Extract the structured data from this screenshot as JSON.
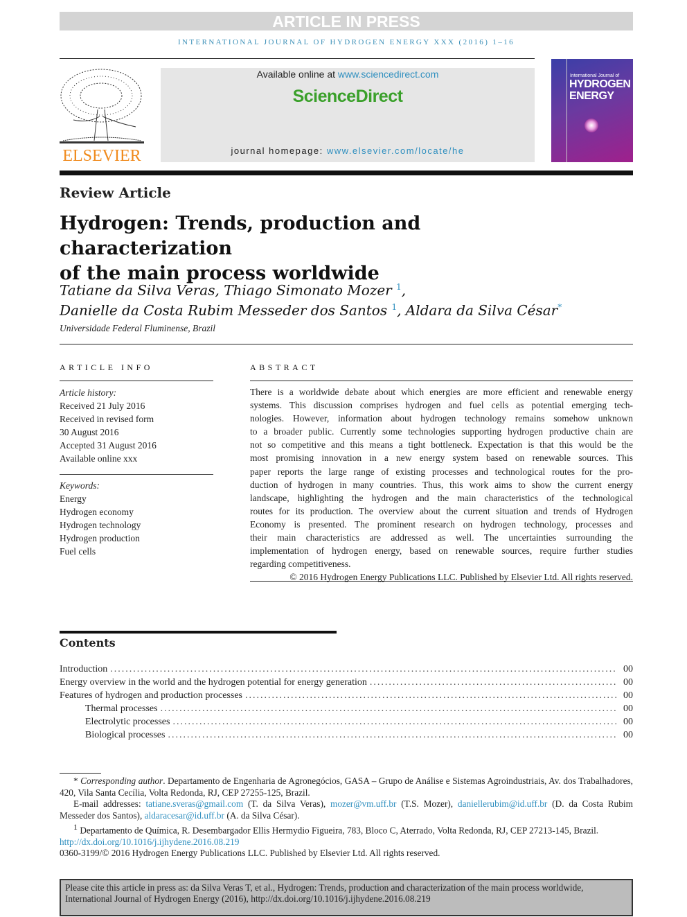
{
  "banner": "ARTICLE IN PRESS",
  "journal_running_head": "INTERNATIONAL JOURNAL OF HYDROGEN ENERGY XXX (2016) 1–16",
  "publisher_logo": "ELSEVIER",
  "header": {
    "available_prefix": "Available online at ",
    "available_link": "www.sciencedirect.com",
    "sciencedirect_logo": "ScienceDirect",
    "homepage_prefix": "journal homepage: ",
    "homepage_link": "www.elsevier.com/locate/he"
  },
  "cover": {
    "line1": "International Journal of",
    "line2": "HYDROGEN",
    "line3": "ENERGY"
  },
  "article_type": "Review Article",
  "title_line1": "Hydrogen: Trends, production and characterization",
  "title_line2": "of the main process worldwide",
  "authors": {
    "a1": "Tatiane da Silva Veras, Thiago Simonato Mozer",
    "a1_sup": "1",
    "a2": "Danielle da Costa Rubim Messeder dos Santos",
    "a2_sup": "1",
    "a3": ", Aldara da Silva César",
    "a3_sup": "*"
  },
  "affiliation": "Universidade Federal Fluminense, Brazil",
  "article_info": {
    "heading": "ARTICLE INFO",
    "history_label": "Article history:",
    "history": [
      "Received 21 July 2016",
      "Received in revised form",
      "30 August 2016",
      "Accepted 31 August 2016",
      "Available online xxx"
    ],
    "keywords_label": "Keywords:",
    "keywords": [
      "Energy",
      "Hydrogen economy",
      "Hydrogen technology",
      "Hydrogen production",
      "Fuel cells"
    ]
  },
  "abstract": {
    "heading": "ABSTRACT",
    "lines": [
      "There is a worldwide debate about which energies are more efficient and renewable energy",
      "systems. This discussion comprises hydrogen and fuel cells as potential emerging tech-",
      "nologies. However, information about hydrogen technology remains somehow unknown",
      "to a broader public. Currently some technologies supporting hydrogen productive chain are",
      "not so competitive and this means a tight bottleneck. Expectation is that this would be the",
      "most promising innovation in a new energy system based on renewable sources. This",
      "paper reports the large range of existing processes and technological routes for the pro-",
      "duction of hydrogen in many countries. Thus, this work aims to show the current energy",
      "landscape, highlighting the hydrogen and the main characteristics of the technological",
      "routes for its production. The overview about the current situation and trends of Hydrogen",
      "Economy is presented. The prominent research on hydrogen technology, processes and",
      "their main characteristics are addressed as well. The uncertainties surrounding the",
      "implementation of hydrogen energy, based on renewable sources, require further studies",
      "regarding competitiveness."
    ],
    "copyright": "© 2016 Hydrogen Energy Publications LLC. Published by Elsevier Ltd. All rights reserved."
  },
  "contents": {
    "heading": "Contents",
    "items": [
      {
        "title": "Introduction",
        "page": "00"
      },
      {
        "title": "Energy overview in the world and the hydrogen potential for energy generation",
        "page": "00"
      },
      {
        "title": "Features of hydrogen and production processes",
        "page": "00"
      },
      {
        "title": "Thermal processes",
        "page": "00"
      },
      {
        "title": "Electrolytic processes",
        "page": "00"
      },
      {
        "title": "Biological processes",
        "page": "00"
      }
    ]
  },
  "footnotes": {
    "corr_label": "Corresponding author",
    "corr_text": ". Departamento de Engenharia de Agronegócios, GASA – Grupo de Análise e Sistemas Agroindustriais, Av. dos Trabalhadores, 420, Vila Santa Cecília, Volta Redonda, RJ, CEP 27255-125, Brazil.",
    "email_label": "E-mail addresses: ",
    "emails": [
      {
        "email": "tatiane.sveras@gmail.com",
        "name": " (T. da Silva Veras), "
      },
      {
        "email": "mozer@vm.uff.br",
        "name": " (T.S. Mozer), "
      },
      {
        "email": "daniellerubim@id.uff.br",
        "name": " (D. da Costa Rubim Messeder dos Santos), "
      },
      {
        "email": "aldaracesar@id.uff.br",
        "name": " (A. da Silva César)."
      }
    ],
    "fn1": "Departamento de Química, R. Desembargador Ellis Hermydio Figueira, 783, Bloco C, Aterrado, Volta Redonda, RJ, CEP 27213-145, Brazil.",
    "doi": "http://dx.doi.org/10.1016/j.ijhydene.2016.08.219",
    "issn": "0360-3199/© 2016 Hydrogen Energy Publications LLC. Published by Elsevier Ltd. All rights reserved."
  },
  "cite_box": "Please cite this article in press as: da Silva Veras T, et al., Hydrogen: Trends, production and characterization of the main process worldwide, International Journal of Hydrogen Energy (2016), http://dx.doi.org/10.1016/j.ijhydene.2016.08.219",
  "colors": {
    "link": "#2f8fbf",
    "sciencedirect": "#3aa02a",
    "elsevier": "#f08a1c"
  }
}
